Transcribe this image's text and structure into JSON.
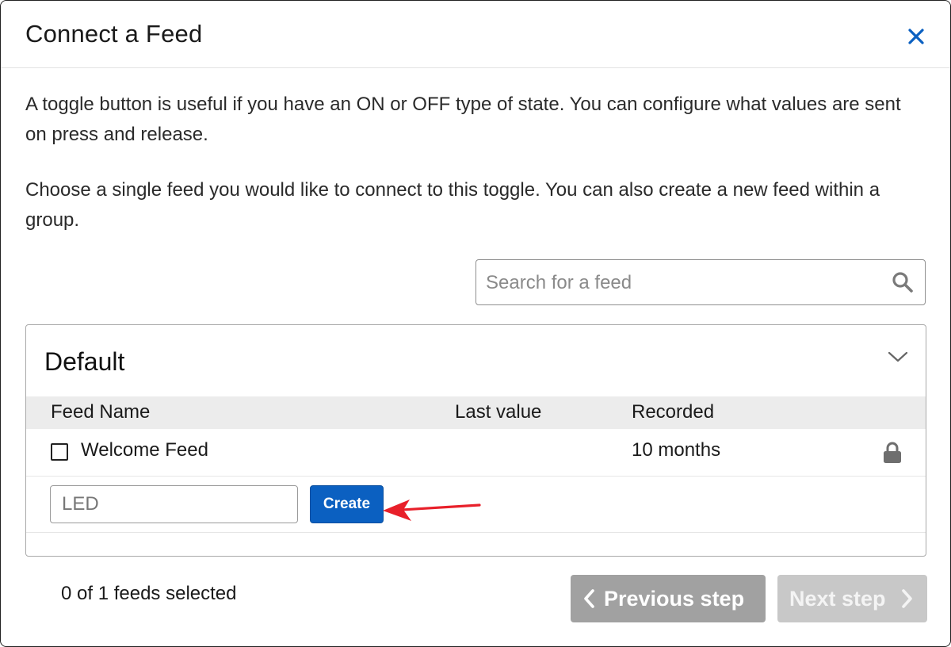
{
  "dialog": {
    "title": "Connect a Feed",
    "close_icon": "close-icon",
    "paragraph1": "A toggle button is useful if you have an ON or OFF type of state. You can configure what values are sent on press and release.",
    "paragraph2": "Choose a single feed you would like to connect to this toggle. You can also create a new feed within a group."
  },
  "search": {
    "placeholder": "Search for a feed",
    "value": "",
    "icon": "search-icon"
  },
  "group": {
    "name": "Default",
    "expand_icon": "chevron-down-icon",
    "columns": [
      "Feed Name",
      "Last value",
      "Recorded"
    ],
    "feeds": [
      {
        "name": "Welcome Feed",
        "last_value": "",
        "recorded": "10 months",
        "checked": false,
        "icon": "lock-icon"
      }
    ],
    "new_feed": {
      "value": "LED",
      "create_label": "Create"
    }
  },
  "footer": {
    "selection_count": "0 of 1 feeds selected",
    "previous_label": "Previous step",
    "next_label": "Next step"
  },
  "colors": {
    "primary": "#0b60c1",
    "close_icon": "#0b60c1",
    "annotation_arrow": "#e8202a",
    "prev_button": "#a1a1a1",
    "next_button_disabled": "#c8c8c8"
  }
}
